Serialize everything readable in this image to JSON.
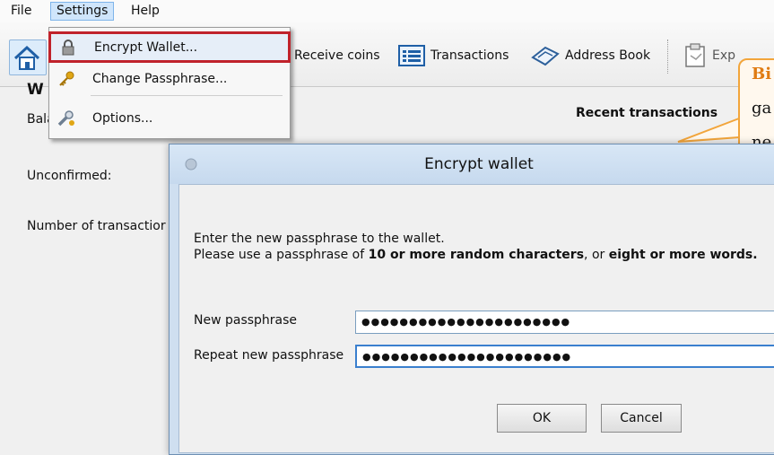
{
  "menubar": {
    "items": [
      "File",
      "Settings",
      "Help"
    ]
  },
  "toolbar": {
    "receive_label": "Receive coins",
    "transactions_label": "Transactions",
    "address_book_label": "Address Book",
    "export_label": "Exp"
  },
  "settings_menu": {
    "items": [
      "Encrypt Wallet...",
      "Change Passphrase...",
      "Options..."
    ]
  },
  "overview": {
    "heading_partial": "W",
    "balance_label": "Balance:",
    "unconfirmed_label": "Unconfirmed:",
    "num_tx_label": "Number of transactior",
    "recent_label": "Recent transactions"
  },
  "callout": {
    "lines": [
      "Bi",
      "ga",
      "ne"
    ]
  },
  "dialog": {
    "title": "Encrypt wallet",
    "intro_line1": "Enter the new passphrase to the wallet.",
    "intro_line2_a": "Please use a passphrase of ",
    "intro_line2_b": "10 or more random characters",
    "intro_line2_c": ", or ",
    "intro_line2_d": "eight or more words.",
    "new_pass_label": "New passphrase",
    "new_pass_value": "●●●●●●●●●●●●●●●●●●●●●●",
    "repeat_pass_label": "Repeat new passphrase",
    "repeat_pass_value": "●●●●●●●●●●●●●●●●●●●●●●",
    "ok_label": "OK",
    "cancel_label": "Cancel"
  },
  "colors": {
    "highlight_border": "#c0222b",
    "callout_border": "#f2a53b",
    "callout_text": "#e07b12"
  }
}
